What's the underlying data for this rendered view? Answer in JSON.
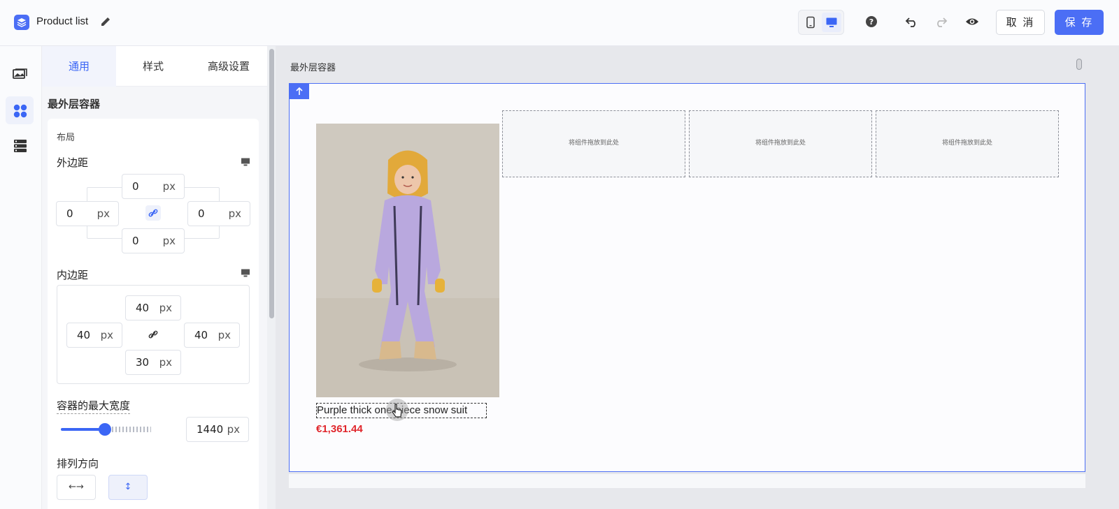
{
  "header": {
    "app_title": "Product list",
    "cancel_label": "取 消",
    "save_label": "保 存"
  },
  "panel": {
    "tabs": [
      {
        "label": "通用",
        "active": true
      },
      {
        "label": "样式",
        "active": false
      },
      {
        "label": "高级设置",
        "active": false
      }
    ],
    "section_title": "最外层容器",
    "layout_label": "布局",
    "margin": {
      "label": "外边距",
      "top": "0",
      "left": "0",
      "right": "0",
      "bottom": "0",
      "unit": "px"
    },
    "padding": {
      "label": "内边距",
      "top": "40",
      "left": "40",
      "right": "40",
      "bottom": "30",
      "unit": "px"
    },
    "max_width": {
      "label": "容器的最大宽度",
      "value": "1440",
      "unit": "px"
    },
    "direction": {
      "label": "排列方向",
      "horizontal_glyph": "←→",
      "vertical_glyph": "↕",
      "selected": "vertical"
    }
  },
  "canvas": {
    "container_label": "最外层容器",
    "product": {
      "name": "Purple thick one-piece snow suit",
      "price": "€1,361.44"
    },
    "drop_zones": [
      "将组件拖放到此处",
      "将组件拖放到此处",
      "将组件拖放到此处"
    ]
  },
  "colors": {
    "accent": "#4b6ef5",
    "price": "#e0262c"
  }
}
